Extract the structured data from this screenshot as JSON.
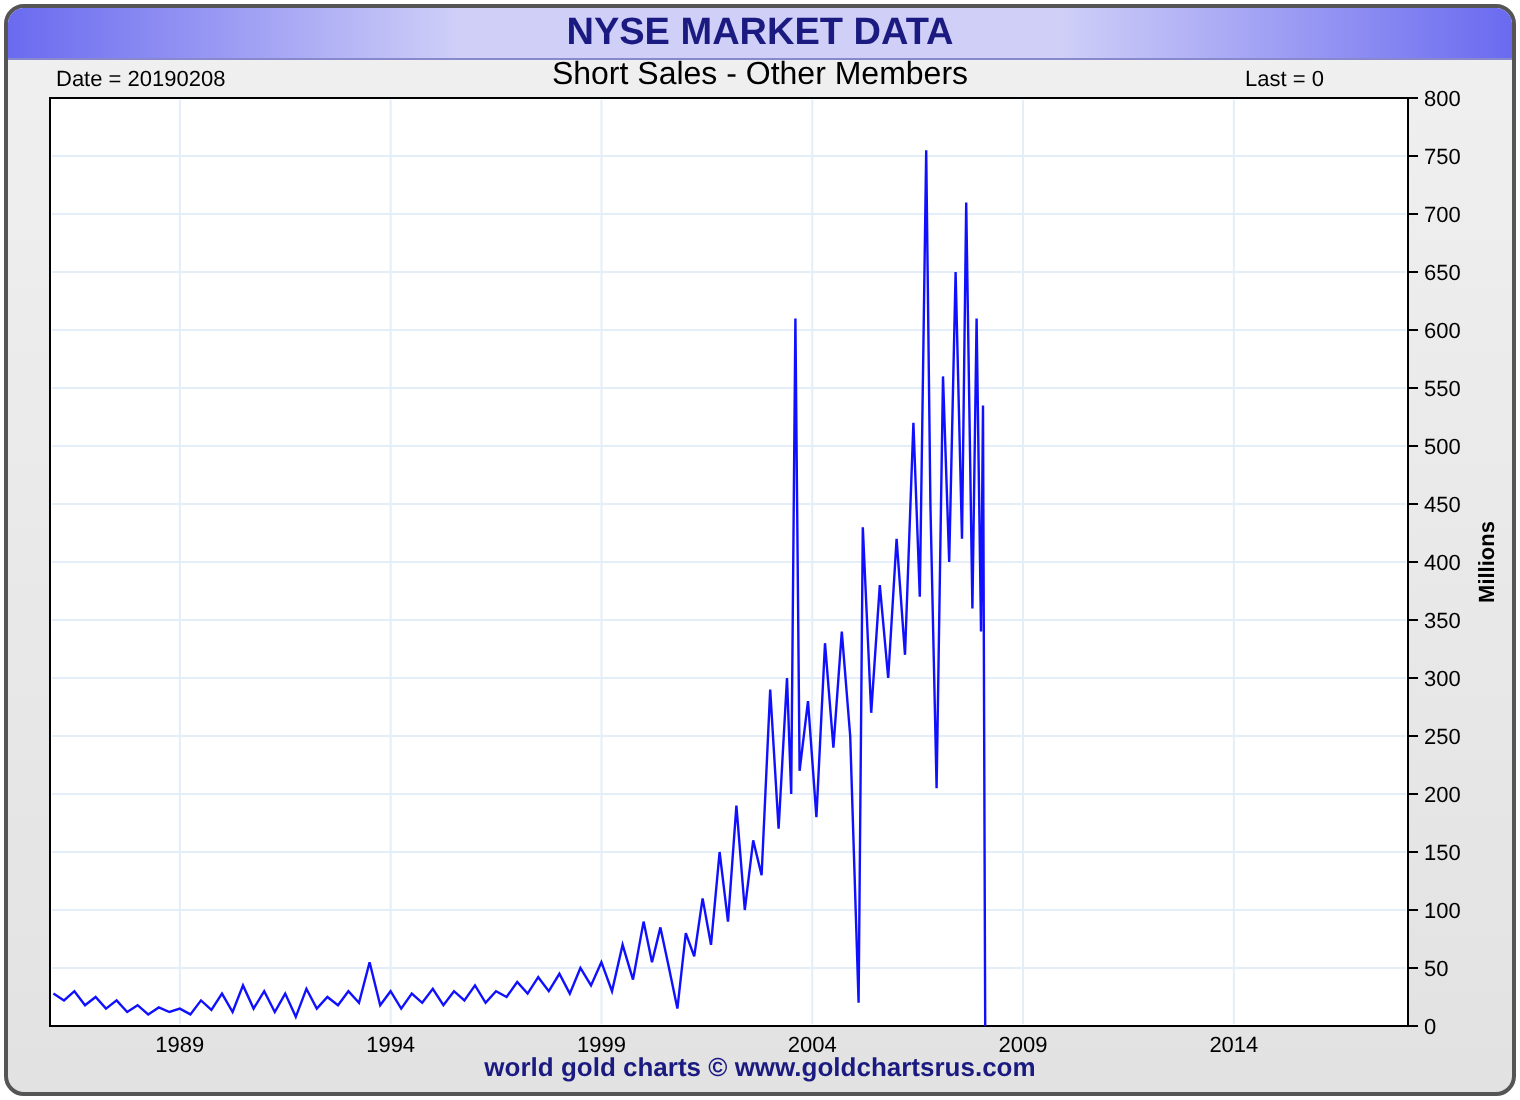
{
  "header": {
    "title": "NYSE MARKET DATA"
  },
  "chart_info": {
    "date": "Date = 20190208",
    "last": "Last = 0"
  },
  "chart": {
    "chart_data": {
      "type": "line",
      "title": "Short Sales - Other Members",
      "ylabel": "Millions",
      "grid": true,
      "xticks": [
        {
          "value": 1989,
          "label": "1989"
        },
        {
          "value": 1994,
          "label": "1994"
        },
        {
          "value": 1999,
          "label": "1999"
        },
        {
          "value": 2004,
          "label": "2004"
        },
        {
          "value": 2009,
          "label": "2009"
        },
        {
          "value": 2014,
          "label": "2014"
        }
      ],
      "yticks": [
        0,
        50,
        100,
        150,
        200,
        250,
        300,
        350,
        400,
        450,
        500,
        550,
        600,
        650,
        700,
        750,
        800
      ],
      "xlim": [
        1985.92,
        2018.13
      ],
      "ylim": [
        0,
        800
      ],
      "x": [
        1986.0,
        1986.25,
        1986.5,
        1986.75,
        1987.0,
        1987.25,
        1987.5,
        1987.75,
        1988.0,
        1988.25,
        1988.5,
        1988.75,
        1989.0,
        1989.25,
        1989.5,
        1989.75,
        1990.0,
        1990.25,
        1990.5,
        1990.75,
        1991.0,
        1991.25,
        1991.5,
        1991.75,
        1992.0,
        1992.25,
        1992.5,
        1992.75,
        1993.0,
        1993.25,
        1993.5,
        1993.75,
        1994.0,
        1994.25,
        1994.5,
        1994.75,
        1995.0,
        1995.25,
        1995.5,
        1995.75,
        1996.0,
        1996.25,
        1996.5,
        1996.75,
        1997.0,
        1997.25,
        1997.5,
        1997.75,
        1998.0,
        1998.25,
        1998.5,
        1998.75,
        1999.0,
        1999.25,
        1999.5,
        1999.75,
        2000.0,
        2000.2,
        2000.4,
        2000.6,
        2000.8,
        2001.0,
        2001.2,
        2001.4,
        2001.6,
        2001.8,
        2002.0,
        2002.2,
        2002.4,
        2002.6,
        2002.8,
        2003.0,
        2003.2,
        2003.4,
        2003.5,
        2003.6,
        2003.7,
        2003.9,
        2004.1,
        2004.3,
        2004.5,
        2004.7,
        2004.9,
        2005.1,
        2005.2,
        2005.4,
        2005.6,
        2005.8,
        2006.0,
        2006.2,
        2006.4,
        2006.55,
        2006.7,
        2006.8,
        2006.95,
        2007.1,
        2007.25,
        2007.4,
        2007.55,
        2007.65,
        2007.8,
        2007.9,
        2008.0,
        2008.05,
        2008.1
      ],
      "values": [
        28,
        22,
        30,
        18,
        25,
        15,
        22,
        12,
        18,
        10,
        16,
        12,
        15,
        10,
        22,
        14,
        28,
        12,
        35,
        15,
        30,
        12,
        28,
        8,
        32,
        15,
        25,
        18,
        30,
        20,
        55,
        18,
        30,
        15,
        28,
        20,
        32,
        18,
        30,
        22,
        35,
        20,
        30,
        25,
        38,
        28,
        42,
        30,
        45,
        28,
        50,
        35,
        55,
        30,
        70,
        40,
        90,
        55,
        85,
        50,
        15,
        80,
        60,
        110,
        70,
        150,
        90,
        190,
        100,
        160,
        130,
        290,
        170,
        300,
        200,
        610,
        220,
        280,
        180,
        330,
        240,
        340,
        250,
        20,
        430,
        270,
        380,
        300,
        420,
        320,
        520,
        370,
        755,
        450,
        205,
        560,
        400,
        650,
        420,
        710,
        360,
        610,
        340,
        535,
        0
      ]
    }
  },
  "footer": {
    "text": "world gold charts © www.goldchartsrus.com"
  }
}
